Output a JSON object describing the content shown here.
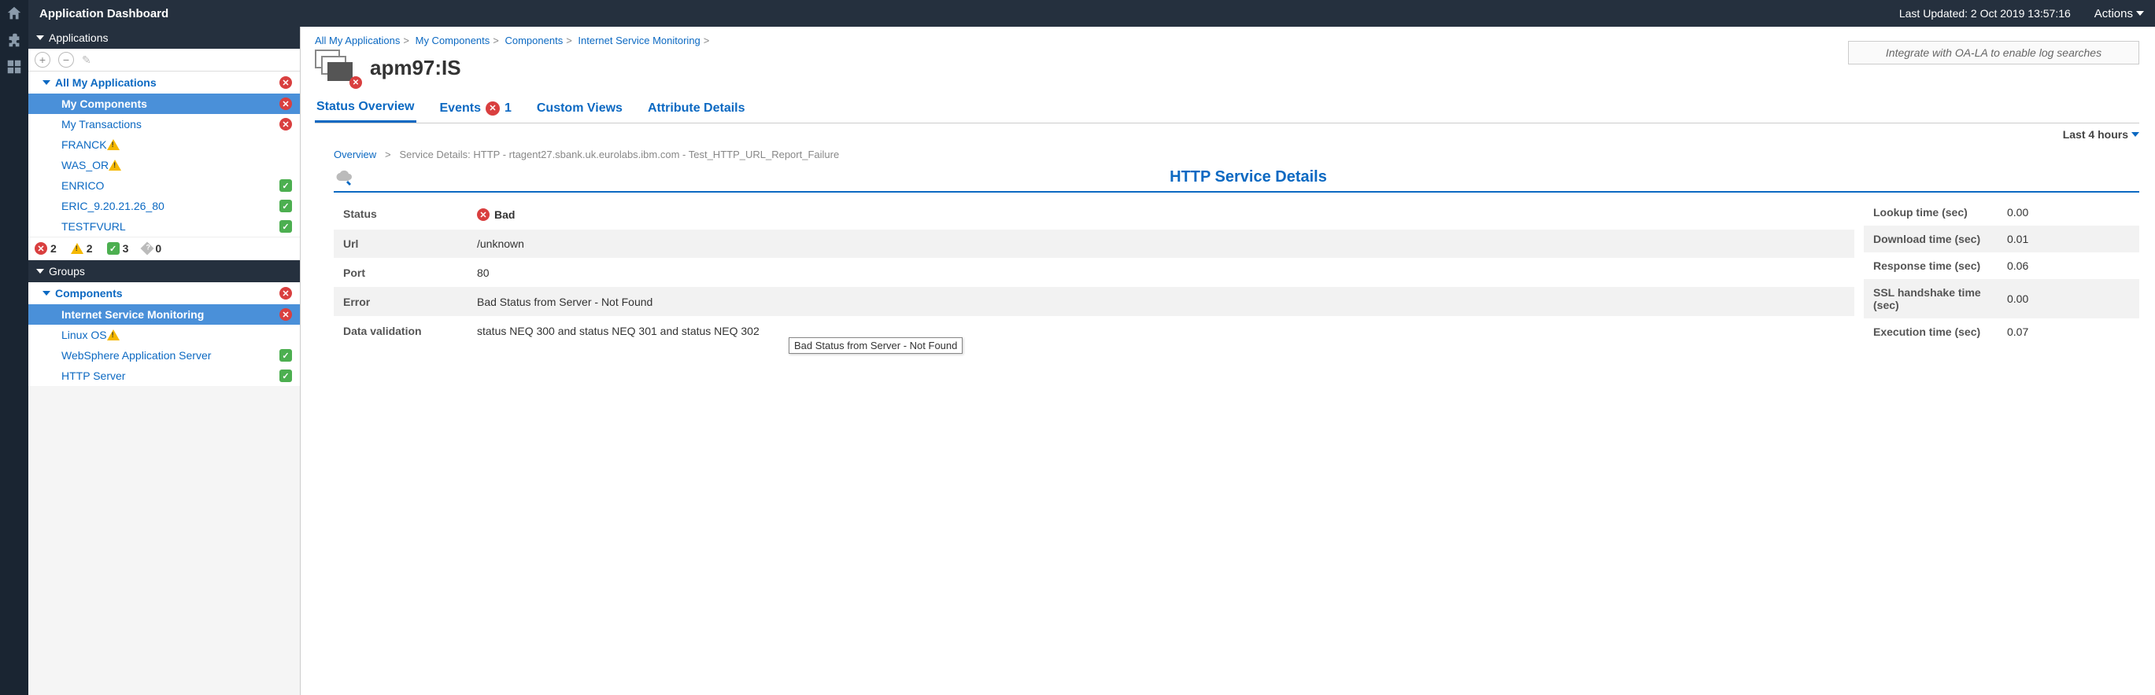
{
  "header": {
    "title": "Application Dashboard",
    "last_updated": "Last Updated: 2 Oct 2019 13:57:16",
    "actions_label": "Actions"
  },
  "sidebar": {
    "applications_label": "Applications",
    "groups_label": "Groups",
    "all_apps_label": "All My Applications",
    "components_label": "Components",
    "apps": [
      {
        "label": "My Components",
        "status": "error",
        "selected": true
      },
      {
        "label": "My Transactions",
        "status": "error"
      },
      {
        "label": "FRANCK",
        "status": "warn"
      },
      {
        "label": "WAS_OR",
        "status": "warn"
      },
      {
        "label": "ENRICO",
        "status": "ok"
      },
      {
        "label": "ERIC_9.20.21.26_80",
        "status": "ok"
      },
      {
        "label": "TESTFVURL",
        "status": "ok"
      }
    ],
    "summary": {
      "error": "2",
      "warn": "2",
      "ok": "3",
      "unknown": "0"
    },
    "components": [
      {
        "label": "Internet Service Monitoring",
        "status": "error",
        "selected": true
      },
      {
        "label": "Linux OS",
        "status": "warn"
      },
      {
        "label": "WebSphere Application Server",
        "status": "ok"
      },
      {
        "label": "HTTP Server",
        "status": "ok"
      }
    ]
  },
  "breadcrumb": {
    "items": [
      "All My Applications",
      "My Components",
      "Components",
      "Internet Service Monitoring"
    ]
  },
  "page_title": "apm97:IS",
  "search_placeholder": "Integrate with OA-LA to enable log searches",
  "tabs": {
    "status_overview": "Status Overview",
    "events": "Events",
    "events_count": "1",
    "custom_views": "Custom Views",
    "attribute_details": "Attribute Details"
  },
  "timerange": "Last 4 hours",
  "crumb2": {
    "overview": "Overview",
    "detail": "Service Details: HTTP - rtagent27.sbank.uk.eurolabs.ibm.com - Test_HTTP_URL_Report_Failure"
  },
  "details_title": "HTTP Service Details",
  "details_left": [
    {
      "label": "Status",
      "value": "Bad",
      "bad": true
    },
    {
      "label": "Url",
      "value": "/unknown"
    },
    {
      "label": "Port",
      "value": "80"
    },
    {
      "label": "Error",
      "value": "Bad Status from Server - Not Found"
    },
    {
      "label": "Data validation",
      "value": "status NEQ 300 and status NEQ 301 and status NEQ 302"
    }
  ],
  "details_right": [
    {
      "label": "Lookup time (sec)",
      "value": "0.00"
    },
    {
      "label": "Download time (sec)",
      "value": "0.01"
    },
    {
      "label": "Response time (sec)",
      "value": "0.06"
    },
    {
      "label": "SSL handshake time (sec)",
      "value": "0.00"
    },
    {
      "label": "Execution time (sec)",
      "value": "0.07"
    }
  ],
  "tooltip_text": "Bad Status from Server - Not Found"
}
